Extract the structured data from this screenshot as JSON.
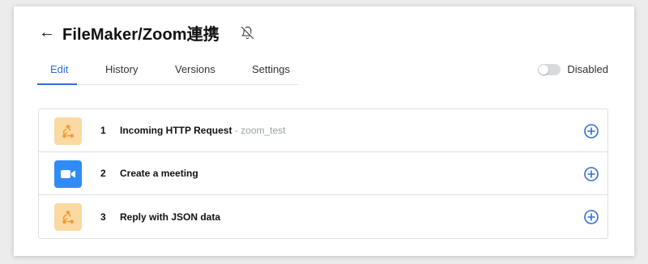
{
  "header": {
    "back_icon": "arrow-left-icon",
    "title": "FileMaker/Zoom連携",
    "bell_icon": "bell-off-icon"
  },
  "tabs": [
    {
      "label": "Edit",
      "active": true
    },
    {
      "label": "History",
      "active": false
    },
    {
      "label": "Versions",
      "active": false
    },
    {
      "label": "Settings",
      "active": false
    }
  ],
  "status": {
    "toggle_on": false,
    "label": "Disabled"
  },
  "steps": [
    {
      "number": "1",
      "title": "Incoming HTTP Request",
      "subtitle": "- zoom_test",
      "icon": "webhook-icon"
    },
    {
      "number": "2",
      "title": "Create a meeting",
      "subtitle": "",
      "icon": "zoom-icon"
    },
    {
      "number": "3",
      "title": "Reply with JSON data",
      "subtitle": "",
      "icon": "webhook-icon"
    }
  ],
  "colors": {
    "accent": "#2f6fd6",
    "webhook_bg": "#fbd9a2",
    "webhook_fg": "#f29b2b",
    "zoom_bg": "#2f8cf6"
  }
}
